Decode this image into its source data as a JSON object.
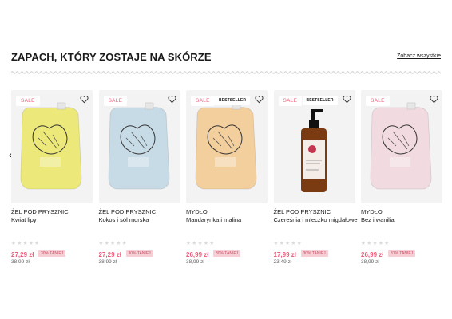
{
  "section": {
    "title": "ZAPACH, KTÓRY ZOSTAJE NA SKÓRZE",
    "see_all": "Zobacz wszystkie"
  },
  "nav": {
    "prev_icon": "chevron-left-icon",
    "next_icon": "chevron-right-icon"
  },
  "colors": {
    "accent": "#ea5d7b",
    "discount_bg": "#f6cfd6",
    "card_bg": "#f3f3f3"
  },
  "products": [
    {
      "badges": {
        "sale": "SALE",
        "bestseller": ""
      },
      "category": "ŻEL POD PRYSZNIC",
      "name": "Kwiat lipy",
      "stars": "★★★★★",
      "price": "27,29 zł",
      "discount": "30% TANIEJ",
      "old_price": "38,99 zł",
      "package": "pouch",
      "package_color": "#ece879"
    },
    {
      "badges": {
        "sale": "SALE",
        "bestseller": ""
      },
      "category": "ŻEL POD PRYSZNIC",
      "name": "Kokos i sól morska",
      "stars": "★★★★★",
      "price": "27,29 zł",
      "discount": "30% TANIEJ",
      "old_price": "38,99 zł",
      "package": "pouch",
      "package_color": "#c7dbe6"
    },
    {
      "badges": {
        "sale": "SALE",
        "bestseller": "BESTSELLER"
      },
      "category": "MYDŁO",
      "name": "Mandarynka i malina",
      "stars": "★★★★★",
      "price": "26,99 zł",
      "discount": "30% TANIEJ",
      "old_price": "38,99 zł",
      "package": "pouch",
      "package_color": "#f3cf9e"
    },
    {
      "badges": {
        "sale": "SALE",
        "bestseller": "BESTSELLER"
      },
      "category": "ŻEL POD PRYSZNIC",
      "name": "Czereśnia i mleczko migdałowe",
      "stars": "★★★★★",
      "price": "17,99 zł",
      "discount": "30% TANIEJ",
      "old_price": "23,49 zł",
      "package": "bottle",
      "package_color": "#7a3b12"
    },
    {
      "badges": {
        "sale": "SALE",
        "bestseller": ""
      },
      "category": "MYDŁO",
      "name": "Bez i wanilia",
      "stars": "★★★★★",
      "price": "26,99 zł",
      "discount": "31% TANIEJ",
      "old_price": "38,99 zł",
      "package": "pouch",
      "package_color": "#f2dbe0"
    }
  ]
}
